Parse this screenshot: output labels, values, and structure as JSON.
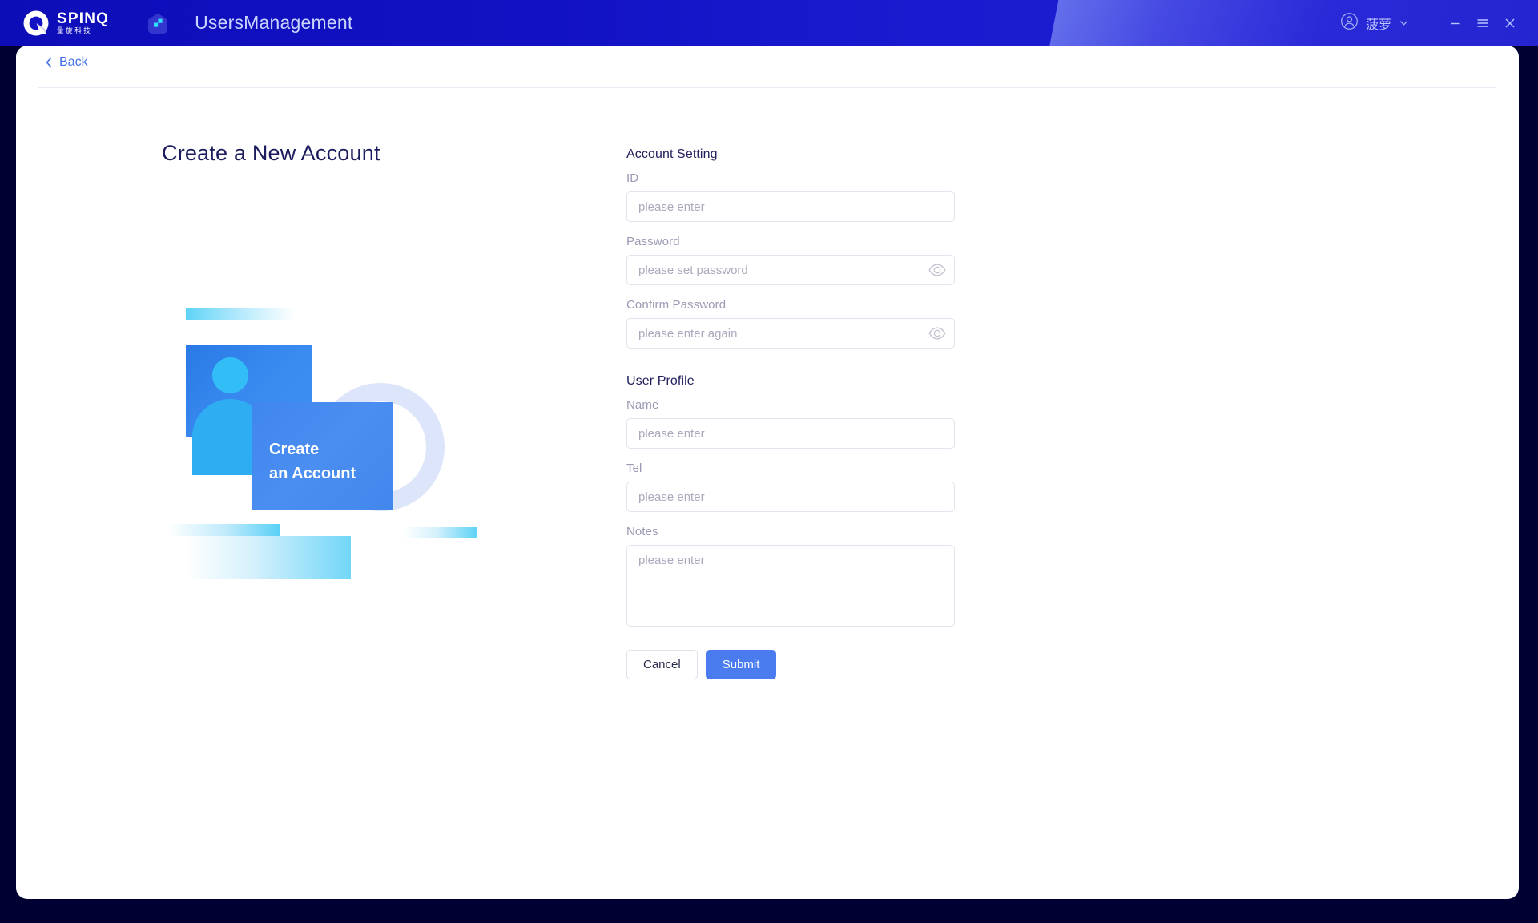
{
  "titlebar": {
    "brand": {
      "wordmark": "SPINQ",
      "subtext": "量旋科技",
      "logo_icon": "spinq-q-logo-icon"
    },
    "app_icon": "app-house-icon",
    "app_title": "UsersManagement",
    "user": {
      "name": "菠萝",
      "avatar_icon": "user-circle-icon",
      "chevron_icon": "chevron-down-icon"
    },
    "window_controls": {
      "minimize_icon": "minimize-icon",
      "menu_icon": "hamburger-menu-icon",
      "close_icon": "close-icon"
    },
    "colors": {
      "bg_left": "#0d0db8",
      "bg_right": "#2020cf",
      "swoosh": "#4a4ee4",
      "title_text": "#c9d4ff"
    }
  },
  "nav": {
    "back_label": "Back",
    "back_icon": "chevron-left-icon",
    "back_color": "#3f6fe8"
  },
  "page": {
    "title": "Create a New Account",
    "title_color": "#1c1c5e"
  },
  "illustration": {
    "card_text": "Create\nan Account",
    "avatar_icon": "user-avatar-illustration",
    "ring_color": "#dde5fb",
    "card_color": "#4b8ef1",
    "accent_color": "#58d0f7"
  },
  "form": {
    "sections": [
      {
        "title": "Account Setting"
      },
      {
        "title": "User Profile"
      }
    ],
    "account": {
      "id": {
        "label": "ID",
        "value": "",
        "placeholder": "please enter"
      },
      "password": {
        "label": "Password",
        "value": "",
        "placeholder": "please set password",
        "toggle_icon": "eye-icon"
      },
      "confirm_password": {
        "label": "Confirm Password",
        "value": "",
        "placeholder": "please enter again",
        "toggle_icon": "eye-icon"
      }
    },
    "profile": {
      "name": {
        "label": "Name",
        "value": "",
        "placeholder": "please enter"
      },
      "tel": {
        "label": "Tel",
        "value": "",
        "placeholder": "please enter"
      },
      "notes": {
        "label": "Notes",
        "value": "",
        "placeholder": "please enter"
      }
    },
    "buttons": {
      "cancel": "Cancel",
      "submit": "Submit",
      "submit_color": "#4a7cf0"
    }
  }
}
